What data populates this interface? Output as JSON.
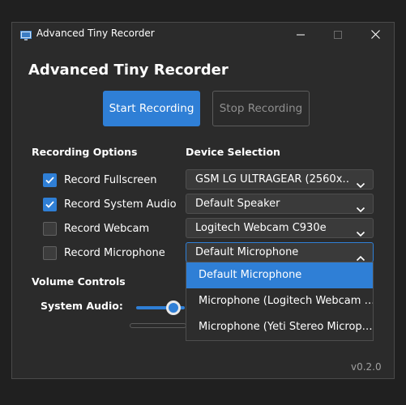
{
  "window": {
    "title": "Advanced Tiny Recorder",
    "controls": {
      "minimize": "minimize",
      "maximize": "maximize",
      "close": "close"
    }
  },
  "app": {
    "heading": "Advanced Tiny Recorder",
    "start_button": "Start Recording",
    "stop_button": "Stop Recording",
    "version": "v0.2.0"
  },
  "recording_options": {
    "title": "Recording Options",
    "items": [
      {
        "label": "Record Fullscreen",
        "checked": true
      },
      {
        "label": "Record System Audio",
        "checked": true
      },
      {
        "label": "Record Webcam",
        "checked": false
      },
      {
        "label": "Record Microphone",
        "checked": false
      }
    ]
  },
  "device_selection": {
    "title": "Device Selection",
    "selects": [
      {
        "value": "GSM LG ULTRAGEAR (2560x…"
      },
      {
        "value": "Default Speaker"
      },
      {
        "value": "Logitech Webcam C930e"
      },
      {
        "value": "Default Microphone"
      }
    ]
  },
  "volume": {
    "title": "Volume Controls",
    "system_audio_label": "System Audio:"
  },
  "microphone_dropdown": {
    "options": [
      "Default Microphone",
      "Microphone (Logitech Webcam …",
      "Microphone (Yeti Stereo Microp…"
    ],
    "selected_index": 0
  },
  "colors": {
    "accent": "#2f7fd6",
    "window_bg": "#2b2b2b",
    "page_bg": "#202020"
  },
  "icons": {
    "app": "recorder-app-icon",
    "check": "checkmark-icon",
    "chevron_down": "chevron-down-icon",
    "chevron_up": "chevron-up-icon"
  }
}
